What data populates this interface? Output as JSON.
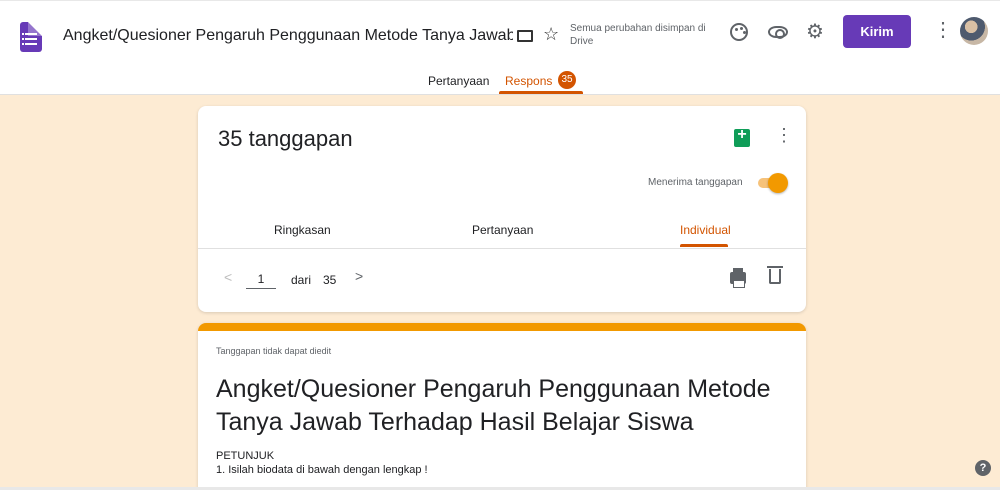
{
  "header": {
    "title": "Angket/Quesioner Pengaruh  Penggunaan Metode Tanya Jawab Terhadap Hasil Belajar Siswa",
    "save_status": "Semua perubahan disimpan di Drive",
    "send_label": "Kirim",
    "icons": [
      "forms-app-icon",
      "folder-icon",
      "star-icon",
      "palette-icon",
      "eye-icon",
      "gear-icon",
      "more-vert-icon",
      "avatar"
    ],
    "accent_color": "#673ab7"
  },
  "tabs": {
    "questions_label": "Pertanyaan",
    "responses_label": "Respons",
    "responses_count": "35",
    "active": "Respons",
    "active_color": "#d35400"
  },
  "responses_card": {
    "title": "35 tanggapan",
    "accepting_label": "Menerima tanggapan",
    "accepting": true,
    "subtabs": [
      "Ringkasan",
      "Pertanyaan",
      "Individual"
    ],
    "active_subtab": "Individual",
    "pager": {
      "current": "1",
      "of_label": "dari",
      "total": "35"
    }
  },
  "form_card": {
    "notice": "Tanggapan tidak dapat diedit",
    "title": "Angket/Quesioner Pengaruh Penggunaan Metode Tanya Jawab Terhadap Hasil Belajar Siswa",
    "description_heading": "PETUNJUK",
    "description_line1": "1.   Isilah biodata di bawah dengan lengkap !",
    "accent_color": "#f29900"
  },
  "background_color": "#fdebd3"
}
